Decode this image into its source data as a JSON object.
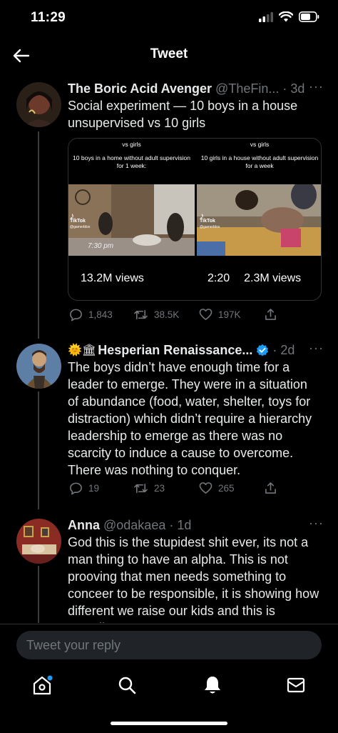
{
  "status_bar": {
    "time": "11:29"
  },
  "header": {
    "title": "Tweet"
  },
  "tweets": [
    {
      "name": "The Boric Acid Avenger",
      "handle": "@TheFin...",
      "time": "· 3d",
      "more": "···",
      "text": "Social experiment — 10 boys in a house unsupervised vs 10 girls",
      "media": [
        {
          "caption_top": "vs girls",
          "caption": "10 boys in a home without adult supervision for 1 week:",
          "tiktok": "TikTok",
          "tiktok_handle": "@gamerblox",
          "timestamp": "7:30 pm",
          "duration": "",
          "views": "13.2M views"
        },
        {
          "caption_top": "vs girls",
          "caption": "10 girls in a house without adult supervision for a week",
          "tiktok": "TikTok",
          "tiktok_handle": "@gamerblox",
          "timestamp": "",
          "duration": "2:20",
          "views": "2.3M views"
        }
      ],
      "stats": {
        "replies": "1,843",
        "retweets": "38.5K",
        "likes": "197K"
      }
    },
    {
      "emoji": "🌞🏛",
      "name": "Hesperian Renaissance...",
      "handle": "",
      "time": "· 2d",
      "more": "···",
      "text": "The boys didn’t have enough time for a leader to emerge.  They were in a situation of abundance (food, water, shelter, toys for distraction) which didn’t require a hierarchy leadership to emerge as there was no scarcity to induce a cause to overcome. There was nothing to conquer.",
      "stats": {
        "replies": "19",
        "retweets": "23",
        "likes": "265"
      }
    },
    {
      "name": "Anna",
      "handle": "@odakaea",
      "time": "· 1d",
      "more": "···",
      "text": "God this is the stupidest shit ever, its not a man thing to have an alpha. This is not prooving that men needs something to conceer to be responsible, it is showing how different we raise our kids and this is actually..."
    }
  ],
  "reply": {
    "placeholder": "Tweet your reply"
  },
  "tabs": [
    "home",
    "search",
    "notifications",
    "messages"
  ],
  "colors": {
    "accent": "#1d9bf0",
    "muted": "#71767b",
    "background": "#000000"
  }
}
